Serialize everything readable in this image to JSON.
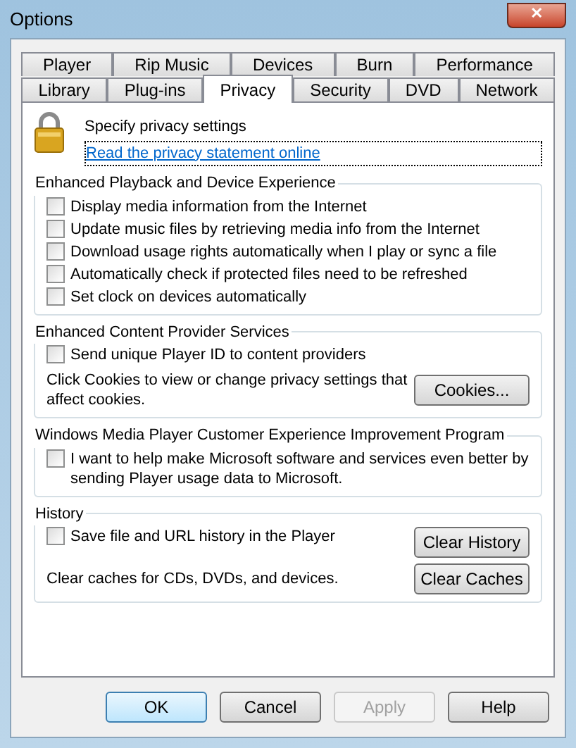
{
  "window": {
    "title": "Options",
    "close": "✕"
  },
  "tab_rows": [
    [
      {
        "label": "Player",
        "selected": false
      },
      {
        "label": "Rip Music",
        "selected": false
      },
      {
        "label": "Devices",
        "selected": false
      },
      {
        "label": "Burn",
        "selected": false
      },
      {
        "label": "Performance",
        "selected": false
      }
    ],
    [
      {
        "label": "Library",
        "selected": false
      },
      {
        "label": "Plug-ins",
        "selected": false
      },
      {
        "label": "Privacy",
        "selected": true
      },
      {
        "label": "Security",
        "selected": false
      },
      {
        "label": "DVD",
        "selected": false
      },
      {
        "label": "Network",
        "selected": false
      }
    ]
  ],
  "header": {
    "title": "Specify privacy settings",
    "link": "Read the privacy statement online"
  },
  "groups": [
    {
      "title": "Enhanced Playback and Device Experience",
      "items": [
        {
          "kind": "checkbox",
          "label": "Display media information from the Internet",
          "checked": false
        },
        {
          "kind": "checkbox",
          "label": "Update music files by retrieving media info from the Internet",
          "checked": false
        },
        {
          "kind": "checkbox",
          "label": "Download usage rights automatically when I play or sync a file",
          "checked": false
        },
        {
          "kind": "checkbox",
          "label": "Automatically check if protected files need to be refreshed",
          "checked": false
        },
        {
          "kind": "checkbox",
          "label": "Set clock on devices automatically",
          "checked": false
        }
      ]
    },
    {
      "title": "Enhanced Content Provider Services",
      "items": [
        {
          "kind": "checkbox",
          "label": "Send unique Player ID to content providers",
          "checked": false
        },
        {
          "kind": "action",
          "label": "Click Cookies to view or change privacy settings that affect cookies.",
          "button": "Cookies..."
        }
      ]
    },
    {
      "title": "Windows Media Player Customer Experience Improvement Program",
      "items": [
        {
          "kind": "checkbox",
          "label": "I want to help make Microsoft software and services even better by sending Player usage data to Microsoft.",
          "checked": false
        }
      ]
    },
    {
      "title": "History",
      "items": [
        {
          "kind": "checkbox",
          "label": "Save file and URL history in the Player",
          "checked": false,
          "button": "Clear History"
        },
        {
          "kind": "action",
          "label": "Clear caches for CDs, DVDs, and devices.",
          "button": "Clear Caches"
        }
      ]
    }
  ],
  "buttons": [
    {
      "label": "OK",
      "default": true,
      "disabled": false
    },
    {
      "label": "Cancel",
      "default": false,
      "disabled": false
    },
    {
      "label": "Apply",
      "default": false,
      "disabled": true
    },
    {
      "label": "Help",
      "default": false,
      "disabled": false
    }
  ]
}
